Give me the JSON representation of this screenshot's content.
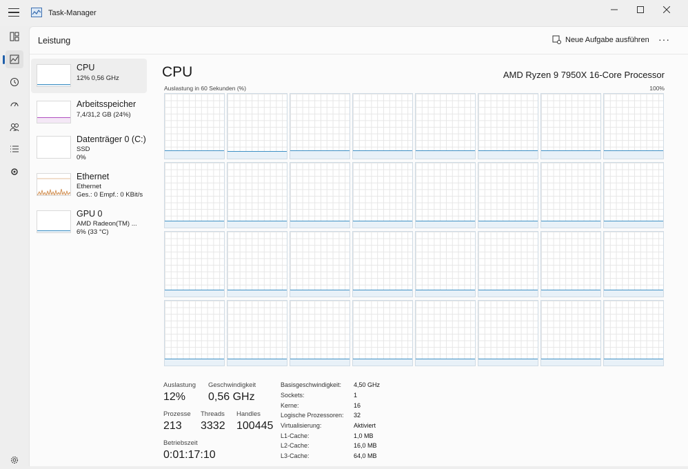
{
  "window": {
    "title": "Task-Manager"
  },
  "header": {
    "title": "Leistung",
    "new_task_label": "Neue Aufgabe ausführen",
    "more_label": "···"
  },
  "nav": [
    "processes-icon",
    "performance-icon",
    "app-history-icon",
    "startup-apps-icon",
    "users-icon",
    "details-icon",
    "services-icon",
    "settings-icon"
  ],
  "sidebar": {
    "items": [
      {
        "name": "CPU",
        "sub1": "12% 0,56 GHz",
        "sub2": "",
        "color": "#3d8fc4"
      },
      {
        "name": "Arbeitsspeicher",
        "sub1": "7,4/31,2 GB (24%)",
        "sub2": "",
        "color": "#b04fc0"
      },
      {
        "name": "Datenträger 0 (C:)",
        "sub1": "SSD",
        "sub2": "0%",
        "color": "#4f9a35"
      },
      {
        "name": "Ethernet",
        "sub1": "Ethernet",
        "sub2": "Ges.: 0 Empf.: 0 KBit/s",
        "color": "#c77a32"
      },
      {
        "name": "GPU 0",
        "sub1": "AMD Radeon(TM) ...",
        "sub2": "6% (33 °C)",
        "color": "#3d8fc4"
      }
    ]
  },
  "detail": {
    "title": "CPU",
    "model": "AMD Ryzen 9 7950X 16-Core Processor",
    "util_label": "Auslastung in 60 Sekunden (%)",
    "util_max": "100%",
    "core_levels": [
      0.12,
      0.11,
      0.12,
      0.12,
      0.12,
      0.12,
      0.12,
      0.12,
      0.1,
      0.1,
      0.1,
      0.1,
      0.1,
      0.1,
      0.1,
      0.1,
      0.1,
      0.1,
      0.1,
      0.1,
      0.1,
      0.1,
      0.1,
      0.1,
      0.1,
      0.1,
      0.1,
      0.1,
      0.1,
      0.1,
      0.1,
      0.1
    ]
  },
  "stats": {
    "auslastung_label": "Auslastung",
    "auslastung_value": "12%",
    "geschw_label": "Geschwindigkeit",
    "geschw_value": "0,56 GHz",
    "prozesse_label": "Prozesse",
    "prozesse_value": "213",
    "threads_label": "Threads",
    "threads_value": "3332",
    "handles_label": "Handles",
    "handles_value": "100445",
    "betrieb_label": "Betriebszeit",
    "betrieb_value": "0:01:17:10"
  },
  "specs": [
    {
      "key": "Basisgeschwindigkeit:",
      "val": "4,50 GHz"
    },
    {
      "key": "Sockets:",
      "val": "1"
    },
    {
      "key": "Kerne:",
      "val": "16"
    },
    {
      "key": "Logische Prozessoren:",
      "val": "32"
    },
    {
      "key": "Virtualisierung:",
      "val": "Aktiviert"
    },
    {
      "key": "L1-Cache:",
      "val": "1,0 MB"
    },
    {
      "key": "L2-Cache:",
      "val": "16,0 MB"
    },
    {
      "key": "L3-Cache:",
      "val": "64,0 MB"
    }
  ]
}
